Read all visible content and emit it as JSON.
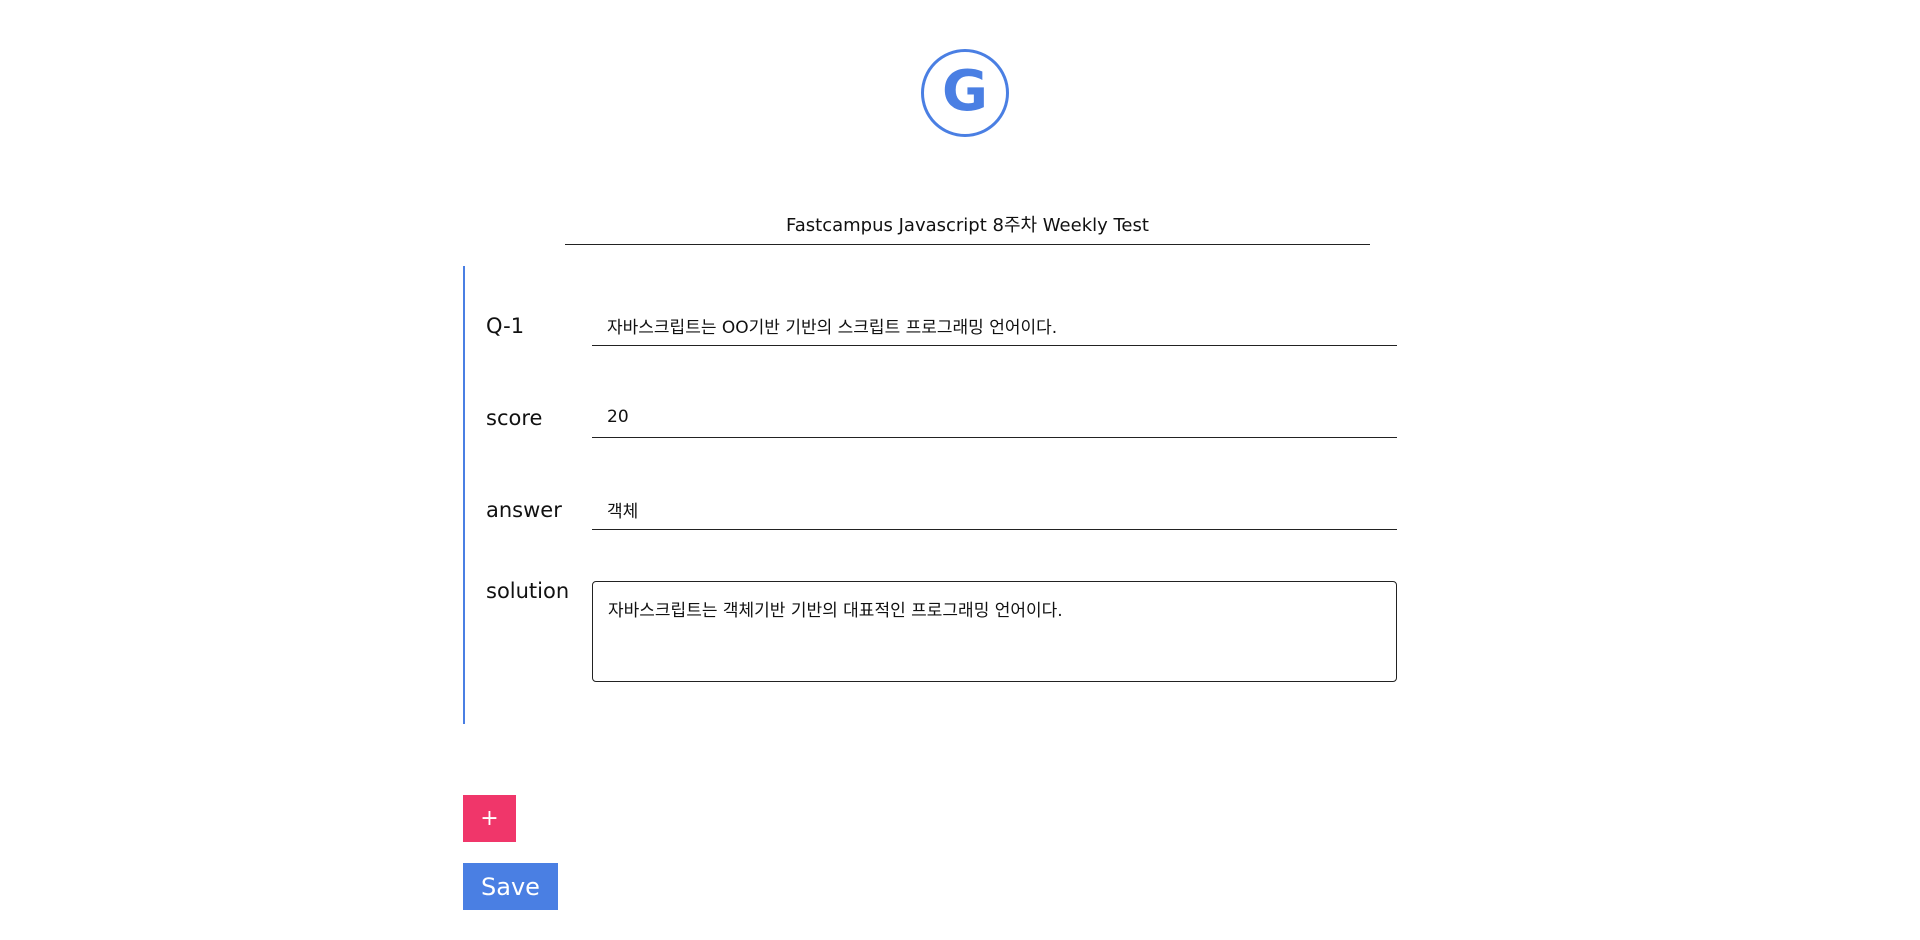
{
  "logo": {
    "letter": "G",
    "icon": "g-logo-icon",
    "color": "#4a7fe3"
  },
  "header": {
    "title": "Fastcampus Javascript 8주차 Weekly Test"
  },
  "question": {
    "label": "Q-1",
    "text": "자바스크립트는 OO기반 기반의 스크립트 프로그래밍 언어이다.",
    "score_label": "score",
    "score_value": "20",
    "answer_label": "answer",
    "answer_value": "객체",
    "solution_label": "solution",
    "solution_value": "자바스크립트는 객체기반 기반의 대표적인 프로그래밍 언어이다."
  },
  "actions": {
    "add_label": "+",
    "save_label": "Save"
  },
  "colors": {
    "accent": "#4a7fe3",
    "add_button": "#f0366a"
  }
}
